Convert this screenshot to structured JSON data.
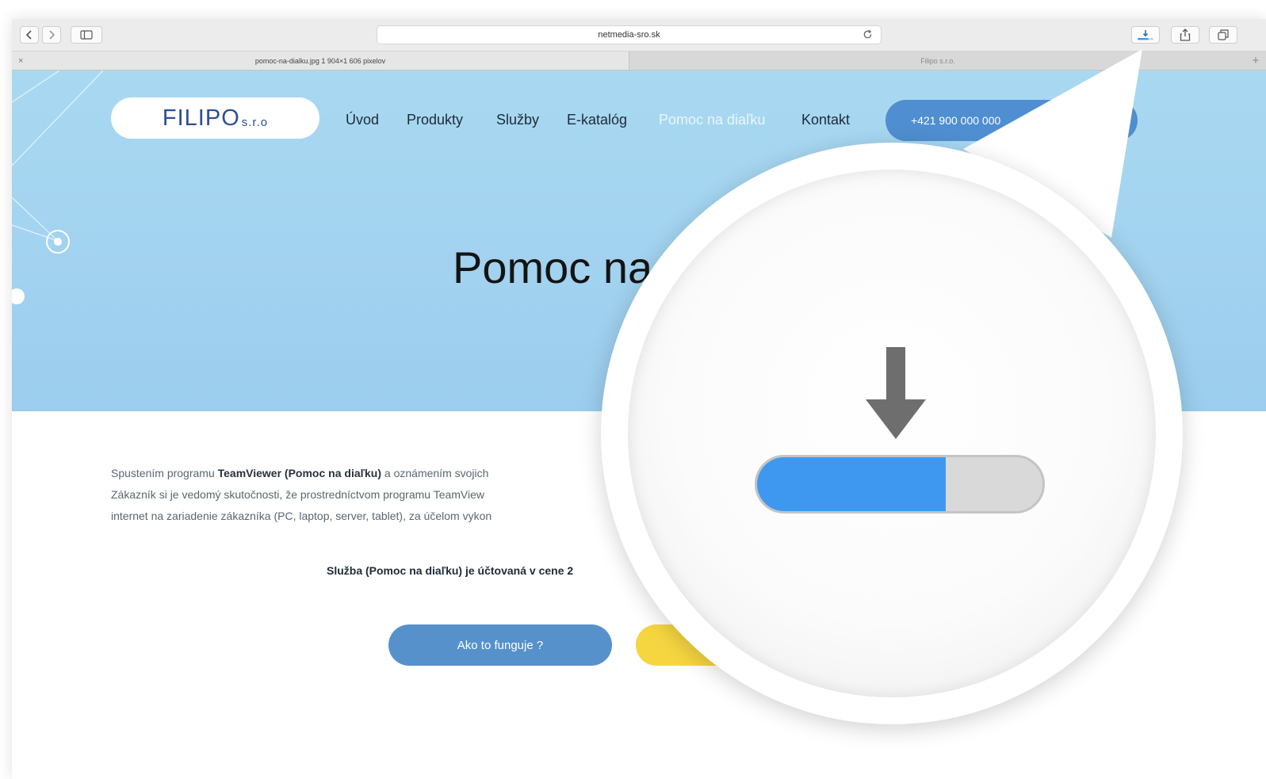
{
  "browser": {
    "url": "netmedia-sro.sk",
    "tabs": [
      {
        "label": "pomoc-na-dialku.jpg 1 904×1 606 pixelov"
      },
      {
        "label": "Filipo s.r.o."
      }
    ],
    "icons": [
      "back-icon",
      "forward-icon",
      "sidebar-icon",
      "reload-icon",
      "downloads-icon",
      "share-icon",
      "tabs-icon",
      "close-icon",
      "plus-icon"
    ]
  },
  "site": {
    "logo": {
      "main": "FILIPO",
      "suffix": "s.r.o"
    },
    "nav": [
      "Úvod",
      "Produkty",
      "Služby",
      "E-katalóg",
      "Pomoc na diaľku",
      "Kontakt"
    ],
    "phone": "+421 900 000 000",
    "hero_title": "Pomoc na",
    "intro": {
      "line1_a": "Spustením programu ",
      "line1_b": "TeamViewer (Pomoc na diaľku)",
      "line1_c": " a oznámením svojich",
      "line2": "Zákazník si je vedomý skutočnosti, že prostredníctvom programu TeamView",
      "line3": "internet na zariadenie zákazníka (PC, laptop, server, tablet), za účelom vykon"
    },
    "price_text": "Služba (Pomoc na diaľku) je účtovaná v cene 2",
    "btn_how": "Ako to funguje ?"
  },
  "overlay": {
    "icon": "download-arrow-icon",
    "progress": 0.66,
    "colors": {
      "fill": "#3f98ef",
      "track": "#d9d9d9",
      "arrow": "#6e6e6e"
    }
  },
  "colors": {
    "hero": "#a9d9f1",
    "nav_active": "#e9f5fc",
    "phone_button": "#4f8ed0",
    "button_blue": "#5691cc",
    "button_yellow": "#f6d640"
  }
}
